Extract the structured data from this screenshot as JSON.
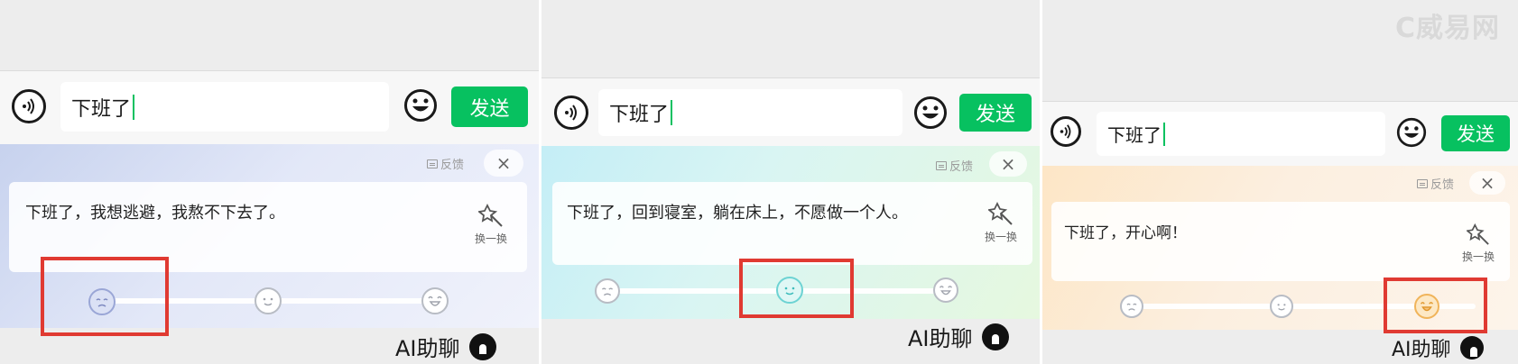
{
  "colors": {
    "send_green": "#07c160",
    "highlight_red": "#e03a32",
    "caret_green": "#07c160"
  },
  "watermark": "C威易网",
  "panels": [
    {
      "input_text": "下班了",
      "send_label": "发送",
      "feedback_label": "反馈",
      "close_icon": "×",
      "suggestion": "下班了，我想逃避，我熬不下去了。",
      "refresh_label": "换一换",
      "moods": [
        "sad-face-icon",
        "calm-face-icon",
        "happy-face-icon"
      ],
      "selected_mood": 0,
      "footer_label": "AI助聊"
    },
    {
      "input_text": "下班了",
      "send_label": "发送",
      "feedback_label": "反馈",
      "close_icon": "×",
      "suggestion": "下班了，回到寝室，躺在床上，不愿做一个人。",
      "refresh_label": "换一换",
      "moods": [
        "sad-face-icon",
        "calm-face-icon",
        "happy-face-icon"
      ],
      "selected_mood": 1,
      "footer_label": "AI助聊"
    },
    {
      "input_text": "下班了",
      "send_label": "发送",
      "feedback_label": "反馈",
      "close_icon": "×",
      "suggestion": "下班了，开心啊！",
      "refresh_label": "换一换",
      "moods": [
        "sad-face-icon",
        "calm-face-icon",
        "happy-face-icon"
      ],
      "selected_mood": 2,
      "footer_label": "AI助聊"
    }
  ]
}
